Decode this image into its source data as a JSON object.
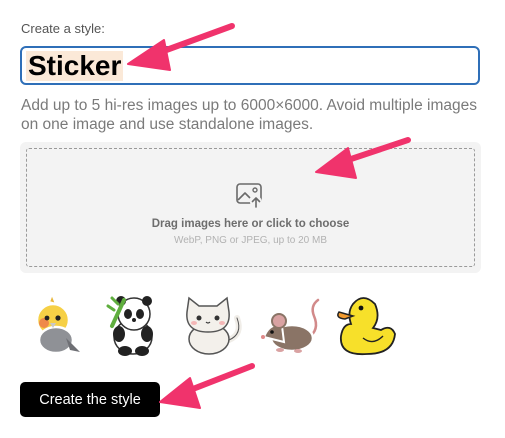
{
  "form": {
    "label": "Create a style:",
    "style_name_value": "Sticker",
    "help_text": "Add up to 5 hi-res images up to 6000×6000. Avoid multiple images on one image and use standalone images."
  },
  "dropzone": {
    "title": "Drag images here or click to choose",
    "subtitle": "WebP, PNG or JPEG, up to 20 MB",
    "icon": "image-upload-icon"
  },
  "thumbnails": [
    {
      "name": "cockatiel-sticker"
    },
    {
      "name": "panda-sticker"
    },
    {
      "name": "cat-sticker"
    },
    {
      "name": "mouse-sticker"
    },
    {
      "name": "duck-sticker"
    }
  ],
  "actions": {
    "create_label": "Create the style"
  },
  "colors": {
    "accent_arrow": "#f0336c",
    "input_border": "#2f6fb8",
    "button_bg": "#000000"
  }
}
